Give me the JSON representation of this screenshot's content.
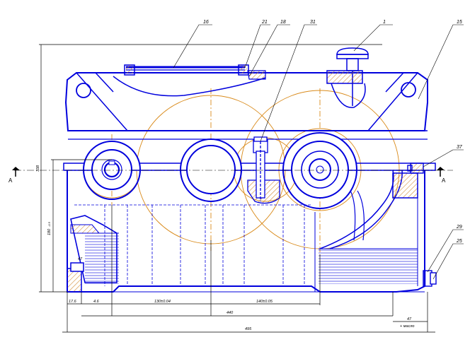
{
  "drawing": {
    "callouts": [
      "16",
      "21",
      "18",
      "31",
      "1",
      "15",
      "37",
      "29",
      "25"
    ],
    "section_marks": [
      "A",
      "A"
    ],
    "dimensions": {
      "overall_height": "338",
      "axis_height": "180",
      "axis_height_tol": "-0.5",
      "wall_left": "17.6",
      "offset_left": "4.6",
      "center_dist_1": "130±0.04",
      "center_dist_2": "140±0.05",
      "span_440": "440",
      "overall_length": "495",
      "level_min": "47",
      "level_mark": "47",
      "oil_level_note": "+ масло"
    }
  },
  "colors": {
    "outline": "#0000dd",
    "gear_circles": "#d98a1a",
    "hatch": "#cc7a1a",
    "dimension": "#000000",
    "oil": "#0000dd"
  }
}
